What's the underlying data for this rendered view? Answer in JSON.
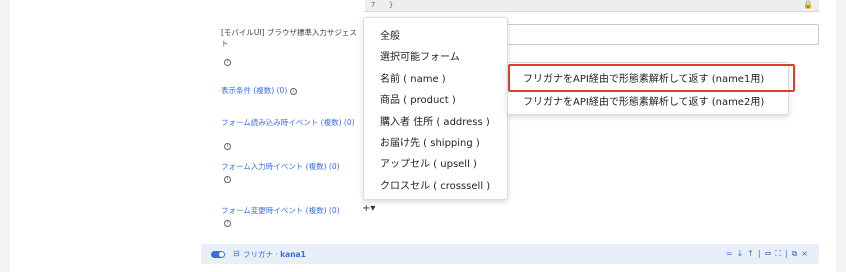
{
  "code_editor": {
    "line_number": "7",
    "content": "}",
    "lock_icon": "lock-icon"
  },
  "labels": {
    "input_suggest": "[モバイルUI] ブラウザ標準入力サジェスト",
    "display_condition": "表示条件 (複数) (0)",
    "form_load_event": "フォーム読み込み時イベント (複数) (0)",
    "form_input_event": "フォーム入力時イベント (複数) (0)",
    "form_change_event": "フォーム変更時イベント (複数) (0)"
  },
  "menu": {
    "items": [
      "全般",
      "選択可能フォーム",
      "名前 ( name )",
      "商品 ( product )",
      "購入者 住所 ( address )",
      "お届け先 ( shipping )",
      "アップセル ( upsell )",
      "クロスセル ( crosssell )"
    ]
  },
  "submenu": {
    "items": [
      "フリガナをAPI経由で形態素解析して返す (name1用)",
      "フリガナをAPI経由で形態素解析して返す (name2用)"
    ]
  },
  "add_button": {
    "label": "+▾"
  },
  "field_row": {
    "toggle_on": true,
    "name_prefix": "フリガナ · ",
    "name_key": "kana1",
    "tools": [
      "=",
      "↓",
      "↑",
      "|",
      "⇔",
      "⛶",
      "|",
      "⧉",
      "×"
    ]
  },
  "colors": {
    "accent": "#3b6fd4",
    "highlight": "#d9402b"
  }
}
